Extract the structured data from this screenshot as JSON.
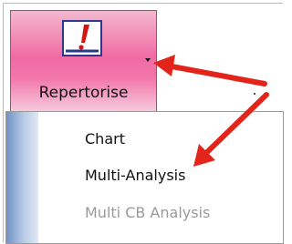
{
  "ribbon": {
    "repertorise_label": "Repertorise",
    "icon": "exclamation-icon"
  },
  "menu": {
    "items": [
      {
        "label": "Chart",
        "enabled": true
      },
      {
        "label": "Multi-Analysis",
        "enabled": true
      },
      {
        "label": "Multi CB Analysis",
        "enabled": false
      }
    ]
  },
  "colors": {
    "button_pink": "#f06aa3",
    "arrow_red": "#e3241b",
    "gutter_blue": "#6f93c6",
    "disabled_text": "#9a9a9a"
  }
}
